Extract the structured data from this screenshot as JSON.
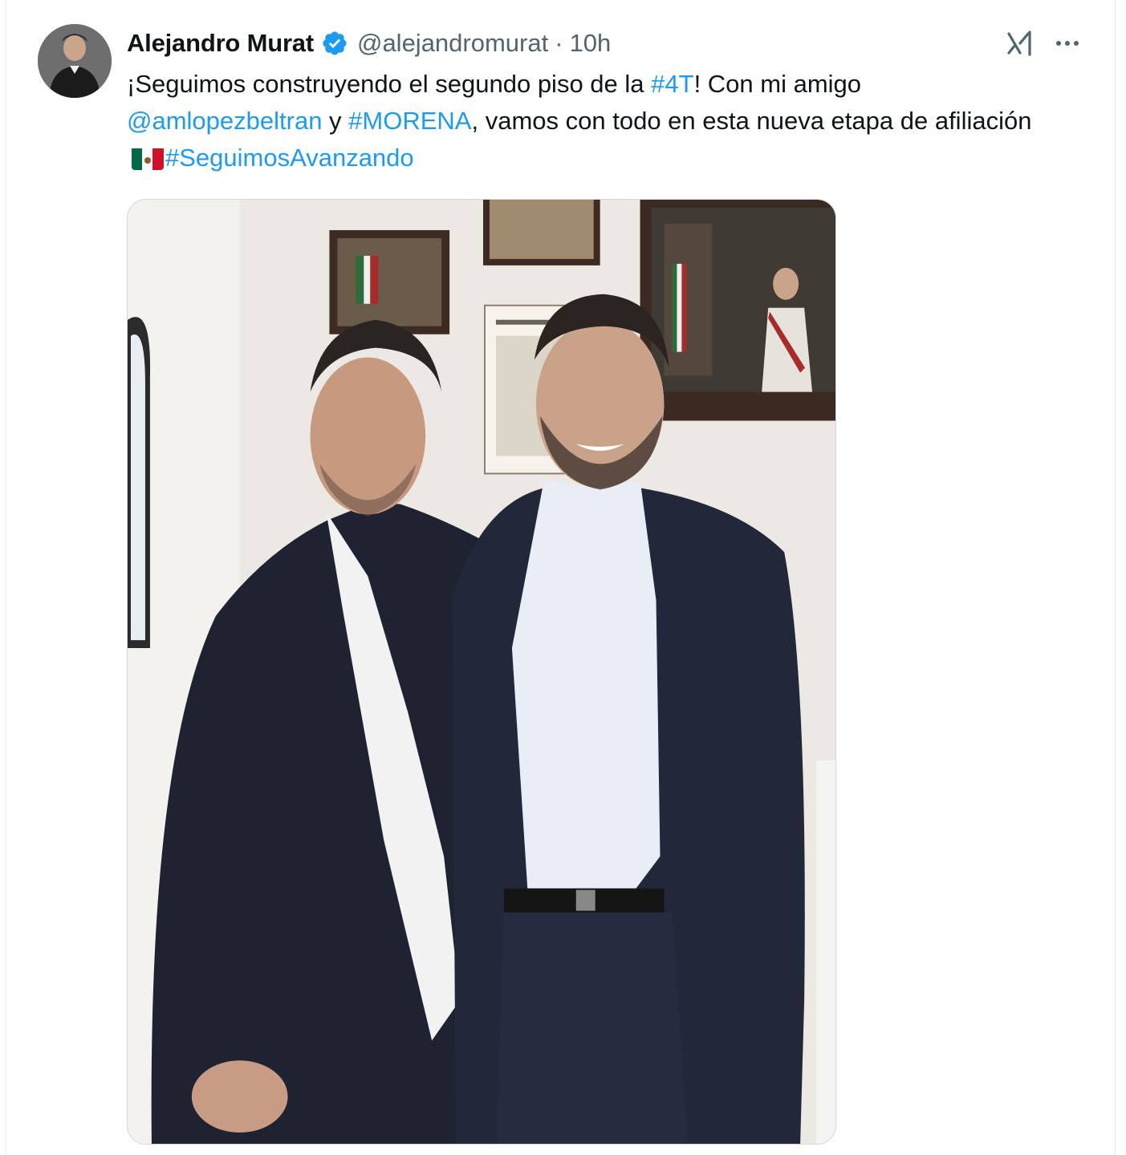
{
  "tweet": {
    "author_name": "Alejandro Murat",
    "handle": "@alejandromurat",
    "separator": "·",
    "timestamp": "10h",
    "text_parts": {
      "p1": "¡Seguimos construyendo el segundo piso de la ",
      "hashtag_4t": "#4T",
      "p2": "! Con mi amigo ",
      "mention": "@amlopezbeltran",
      "p3": " y ",
      "hashtag_morena": "#MORENA",
      "p4": ", vamos con todo en esta nueva etapa de afiliación",
      "hashtag_avanzando": "#SeguimosAvanzando"
    },
    "media_description_icon": "photo"
  },
  "icons": {
    "verified": "verified-badge-icon",
    "grok": "grok-icon",
    "more": "more-options-icon",
    "flag": "mexico-flag-emoji"
  },
  "colors": {
    "text": "#0f1419",
    "secondary": "#536471",
    "link": "#1d9bf0",
    "verified": "#1d9bf0"
  }
}
